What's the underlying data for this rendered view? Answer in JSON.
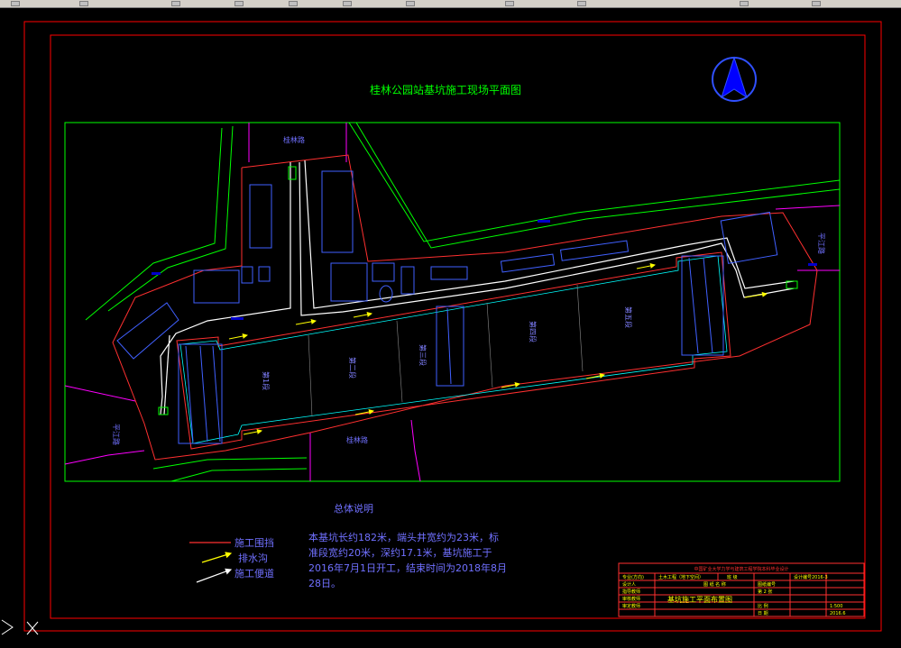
{
  "drawing": {
    "title": "桂林公园站基坑施工现场平面图",
    "north_arrow_icon": "north-arrow-icon"
  },
  "roads": {
    "top": "桂林路",
    "bottom": "桂林路",
    "left": "平江路",
    "right": "平江路"
  },
  "pit_sections": [
    "第1段",
    "第二段",
    "第三段",
    "第四段",
    "第五段"
  ],
  "notes": {
    "heading": "总体说明",
    "body_lines": [
      "本基坑长约182米，端头井宽约为23米，标",
      "准段宽约20米，深约17.1米，基坑施工于",
      "2016年7月1日开工，结束时间为2018年8月",
      "28日。"
    ]
  },
  "legend": [
    {
      "label": "施工围挡",
      "color": "#ff3030"
    },
    {
      "label": "排水沟",
      "color": "#ffff00"
    },
    {
      "label": "施工便道",
      "color": "#ffffff"
    }
  ],
  "title_block": {
    "header": "中国矿业大学力学与建筑工程学院本科毕业设计",
    "r1": [
      "专业(方向)",
      "土木工程（地下空间）",
      "班 级",
      "设计编号2016-3"
    ],
    "r2": [
      "设计人",
      "",
      "图 纸 名 称",
      "图纸编号"
    ],
    "r3": [
      "指导教师",
      "",
      "基坑施工平面布置图",
      "第 2 张"
    ],
    "r4": [
      "审核教师",
      "",
      "",
      "比 例"
    ],
    "r5": [
      "审定教师",
      "",
      "",
      "日 期"
    ],
    "r6_right": [
      "1:500",
      "2016.6"
    ]
  },
  "colors": {
    "frame": "#ff0000",
    "green": "#00ff00",
    "magenta": "#ff00ff",
    "blue": "#0000ff",
    "white": "#ffffff",
    "cyan": "#00ffff",
    "yellow": "#ffff00",
    "red": "#ff3030"
  }
}
